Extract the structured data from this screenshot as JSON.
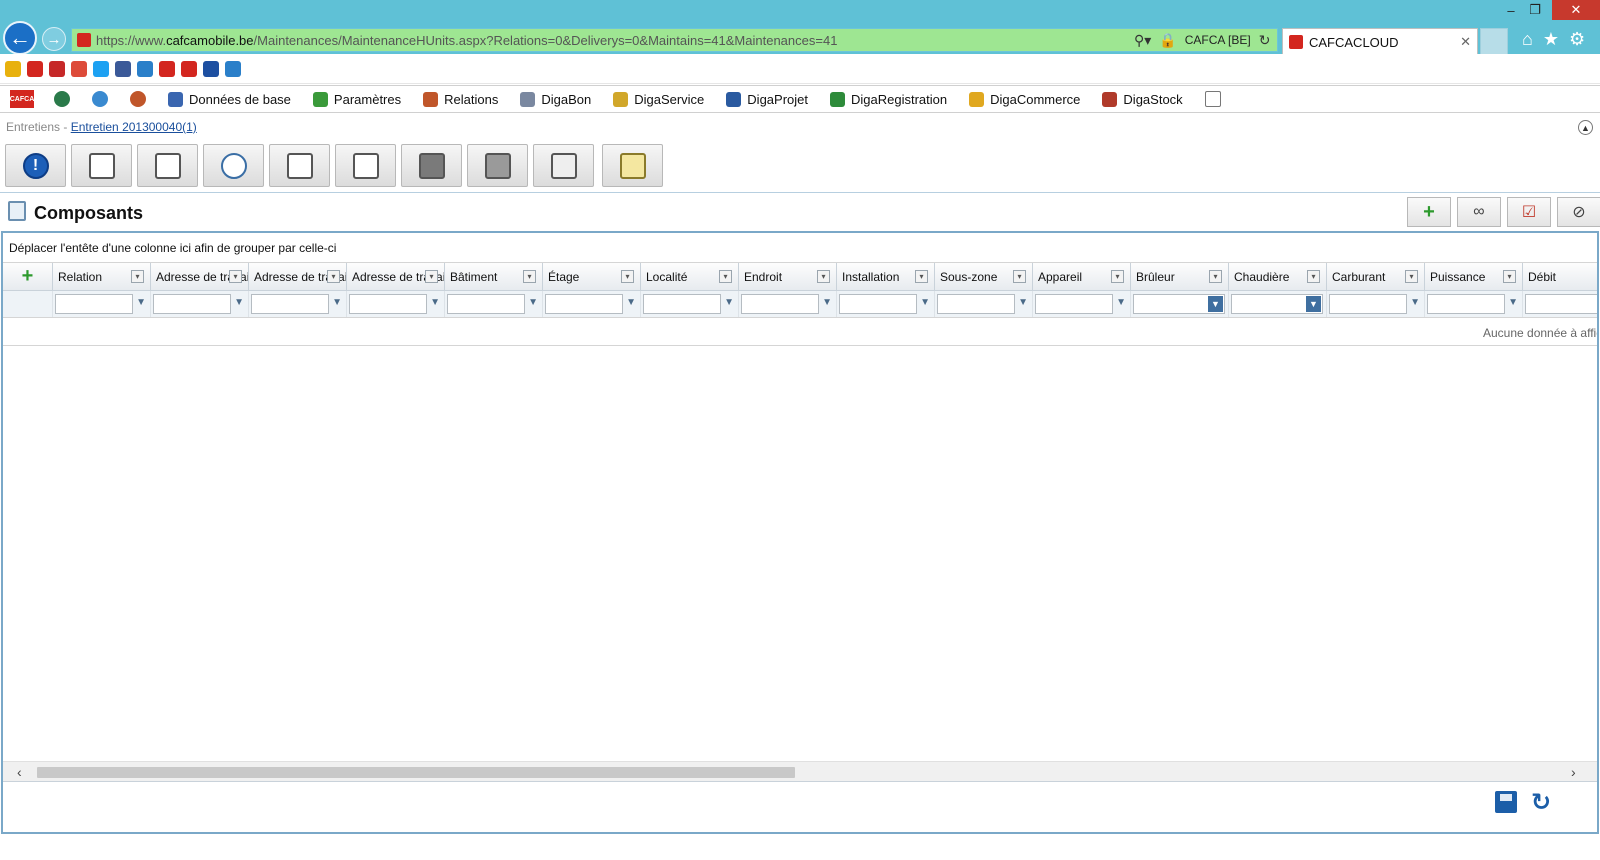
{
  "browser": {
    "url_protocol": "https://www.",
    "url_host": "cafcamobile.be",
    "url_path": "/Maintenances/MaintenanceHUnits.aspx?Relations=0&Deliverys=0&Maintains=41&Maintenances=41",
    "security_label": "CAFCA [BE]",
    "tab_title": "CAFCACLOUD",
    "win_min": "–",
    "win_max": "❐",
    "win_close": "✕"
  },
  "favorites": [
    {
      "icon": "star-add-icon",
      "color": "#e8b10d"
    },
    {
      "icon": "ie-icon",
      "color": "#d3261f"
    },
    {
      "icon": "cafca-icon",
      "color": "#c62828"
    },
    {
      "icon": "google-plus-icon",
      "color": "#dd4b39"
    },
    {
      "icon": "twitter-icon",
      "color": "#1da1f2"
    },
    {
      "icon": "facebook-icon",
      "color": "#3b5998"
    },
    {
      "icon": "ie-page-icon",
      "color": "#2a7fc9"
    },
    {
      "icon": "cafca-red-icon",
      "color": "#d3261f"
    },
    {
      "icon": "c-red-icon",
      "color": "#d3261f"
    },
    {
      "icon": "globe-icon",
      "color": "#1d4fa1"
    },
    {
      "icon": "ie-page2-icon",
      "color": "#2a7fc9"
    }
  ],
  "menu": {
    "logo": "CAFCA",
    "items": [
      {
        "label": "Données de base",
        "color": "#3a66b0"
      },
      {
        "label": "Paramètres",
        "color": "#3a9a3a"
      },
      {
        "label": "Relations",
        "color": "#c0562a"
      },
      {
        "label": "DigaBon",
        "color": "#7a88a0"
      },
      {
        "label": "DigaService",
        "color": "#d1a72a"
      },
      {
        "label": "DigaProjet",
        "color": "#2a5aa0"
      },
      {
        "label": "DigaRegistration",
        "color": "#2e8b3a"
      },
      {
        "label": "DigaCommerce",
        "color": "#e0a820"
      },
      {
        "label": "DigaStock",
        "color": "#b03a2a"
      }
    ]
  },
  "breadcrumb": {
    "root": "Entretiens",
    "separator": " - ",
    "current": "Entretien 201300040(1)"
  },
  "toolbar_icons": [
    "info-icon",
    "washing-machine-icon",
    "checklist-icon",
    "plug-bulb-icon",
    "settings-document-icon",
    "documents-icon",
    "book-icon",
    "printer-icon",
    "folder-icon",
    "folder-clock-icon"
  ],
  "section": {
    "title": "Composants"
  },
  "header_buttons": [
    "add-icon",
    "link-icon",
    "report-icon",
    "cancel-icon"
  ],
  "grid": {
    "group_hint": "Déplacer l'entête d'une colonne ici afin de grouper par celle-ci",
    "columns": [
      {
        "label": "Relation",
        "filter": "text"
      },
      {
        "label": "Adresse de travail",
        "filter": "text"
      },
      {
        "label": "Adresse de travail",
        "filter": "text"
      },
      {
        "label": "Adresse de travail",
        "filter": "text"
      },
      {
        "label": "Bâtiment",
        "filter": "text"
      },
      {
        "label": "Étage",
        "filter": "text"
      },
      {
        "label": "Localité",
        "filter": "text"
      },
      {
        "label": "Endroit",
        "filter": "text"
      },
      {
        "label": "Installation",
        "filter": "text"
      },
      {
        "label": "Sous-zone",
        "filter": "text"
      },
      {
        "label": "Appareil",
        "filter": "text"
      },
      {
        "label": "Brûleur",
        "filter": "dropdown"
      },
      {
        "label": "Chaudière",
        "filter": "dropdown"
      },
      {
        "label": "Carburant",
        "filter": "text"
      },
      {
        "label": "Puissance",
        "filter": "text"
      },
      {
        "label": "Débit",
        "filter": "text"
      }
    ],
    "no_data": "Aucune donnée à afficher",
    "scroll_left": "‹",
    "scroll_right": "›"
  },
  "footer": {
    "save_icon": "save-icon",
    "refresh_icon": "refresh-icon"
  }
}
